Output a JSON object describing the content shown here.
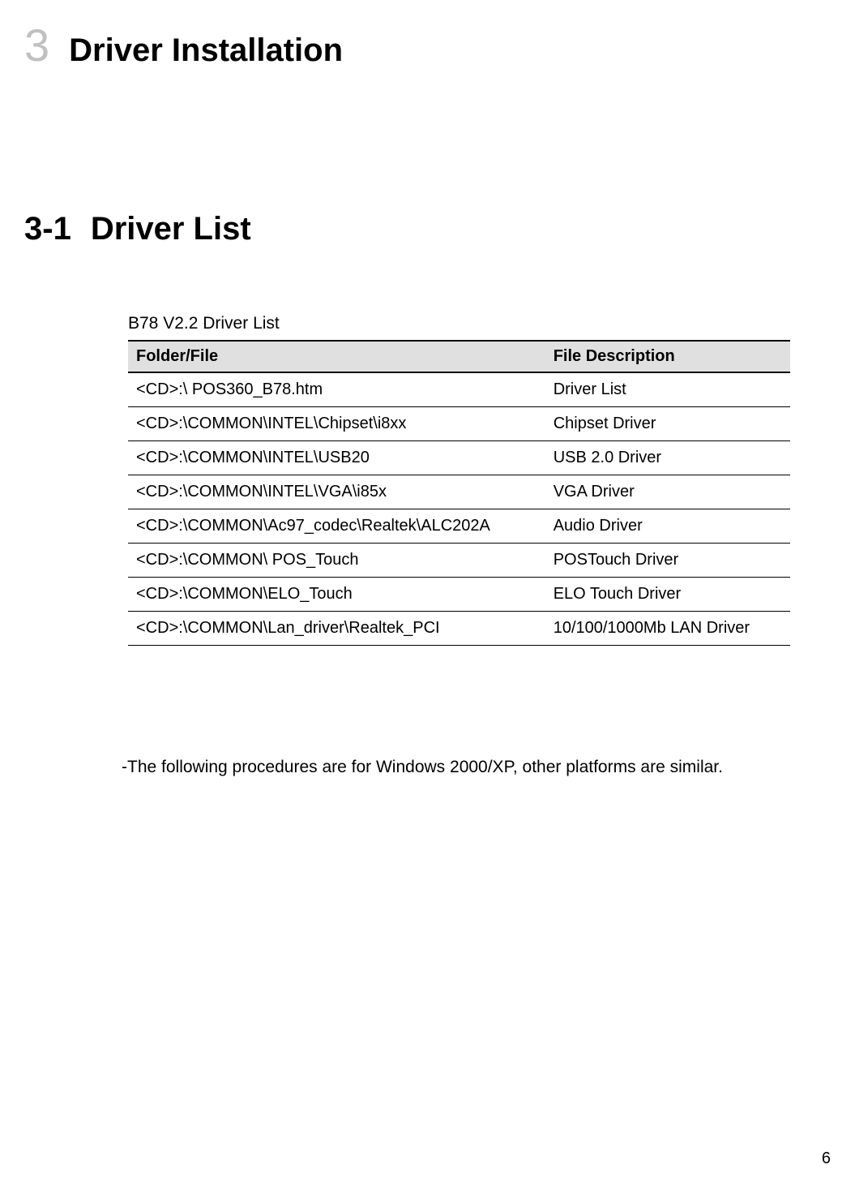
{
  "chapter": {
    "number": "3",
    "title": "Driver Installation"
  },
  "section": {
    "number": "3-1",
    "title": "Driver List"
  },
  "table": {
    "caption": "B78 V2.2 Driver List",
    "headers": {
      "folder": "Folder/File",
      "description": "File Description"
    },
    "rows": [
      {
        "folder": "<CD>:\\ POS360_B78.htm",
        "description": "Driver List"
      },
      {
        "folder": "<CD>:\\COMMON\\INTEL\\Chipset\\i8xx",
        "description": "Chipset Driver"
      },
      {
        "folder": "<CD>:\\COMMON\\INTEL\\USB20",
        "description": "USB 2.0 Driver"
      },
      {
        "folder": "<CD>:\\COMMON\\INTEL\\VGA\\i85x",
        "description": "VGA Driver"
      },
      {
        "folder": "<CD>:\\COMMON\\Ac97_codec\\Realtek\\ALC202A",
        "description": "Audio Driver"
      },
      {
        "folder": "<CD>:\\COMMON\\ POS_Touch",
        "description": "POSTouch Driver"
      },
      {
        "folder": "<CD>:\\COMMON\\ELO_Touch",
        "description": "ELO Touch Driver"
      },
      {
        "folder": "<CD>:\\COMMON\\Lan_driver\\Realtek_PCI",
        "description": "10/100/1000Mb LAN Driver"
      }
    ]
  },
  "note": "-The following procedures are for Windows 2000/XP, other platforms are similar.",
  "page_number": "6"
}
